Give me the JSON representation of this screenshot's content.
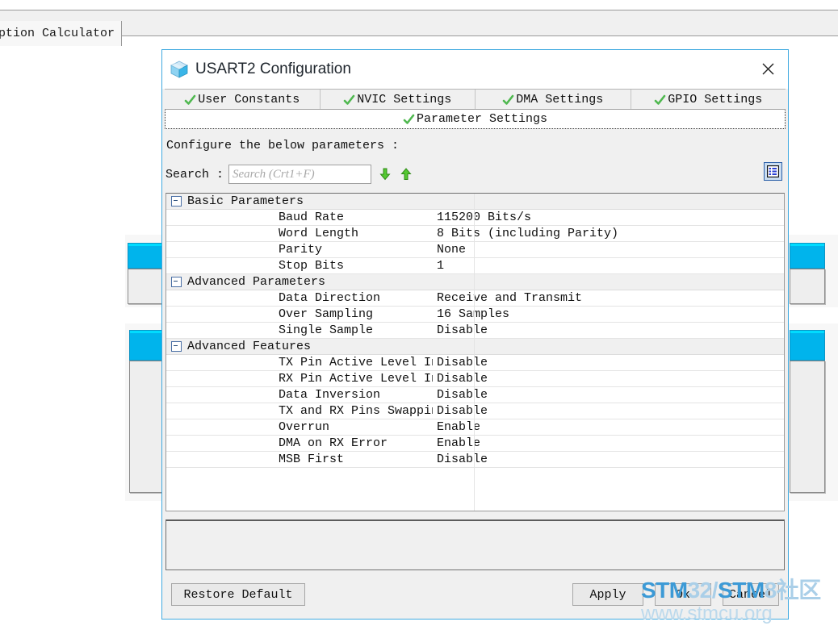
{
  "background": {
    "tab_label": "ption Calculator"
  },
  "dialog": {
    "title": "USART2 Configuration",
    "icon": "cube-icon",
    "close_label": "✕",
    "tabs_top": [
      {
        "label": "User Constants",
        "checked": true
      },
      {
        "label": "NVIC Settings",
        "checked": true
      },
      {
        "label": "DMA Settings",
        "checked": true
      },
      {
        "label": "GPIO Settings",
        "checked": true
      }
    ],
    "tab_active": {
      "label": "Parameter Settings",
      "checked": true
    },
    "configure_label": "Configure the below parameters :",
    "search": {
      "label": "Search :",
      "value": "",
      "placeholder": "Search (Crt1+F)",
      "down_icon": "arrow-down-icon",
      "up_icon": "arrow-up-icon",
      "list_toggle_icon": "list-view-icon"
    },
    "groups": [
      {
        "name": "Basic Parameters",
        "rows": [
          {
            "name": "Baud Rate",
            "value": "115200 Bits/s"
          },
          {
            "name": "Word Length",
            "value": "8 Bits (including Parity)"
          },
          {
            "name": "Parity",
            "value": "None"
          },
          {
            "name": "Stop Bits",
            "value": "1"
          }
        ]
      },
      {
        "name": "Advanced Parameters",
        "rows": [
          {
            "name": "Data Direction",
            "value": "Receive and Transmit"
          },
          {
            "name": "Over Sampling",
            "value": "16 Samples"
          },
          {
            "name": "Single Sample",
            "value": "Disable"
          }
        ]
      },
      {
        "name": "Advanced Features",
        "rows": [
          {
            "name": "TX Pin Active Level Inve...",
            "value": "Disable"
          },
          {
            "name": "RX Pin Active Level Inve...",
            "value": "Disable"
          },
          {
            "name": "Data Inversion",
            "value": "Disable"
          },
          {
            "name": "TX and RX Pins Swapping",
            "value": "Disable"
          },
          {
            "name": "Overrun",
            "value": "Enable"
          },
          {
            "name": "DMA on RX Error",
            "value": "Enable"
          },
          {
            "name": "MSB First",
            "value": "Disable"
          }
        ]
      }
    ],
    "buttons": {
      "restore": "Restore Default",
      "apply": "Apply",
      "ok": "Ok",
      "cancel": "Cancel"
    }
  },
  "watermark": {
    "line1_a": "STM",
    "line1_b": "32/",
    "line1_c": "STM",
    "line1_d": "8社区",
    "line2": "www.stmcu.org"
  },
  "colors": {
    "accent": "#3fa9e0",
    "panel_head": "#00b4ec",
    "tick_green": "#5ec15e",
    "watermark_blue": "#3c9ad6"
  }
}
